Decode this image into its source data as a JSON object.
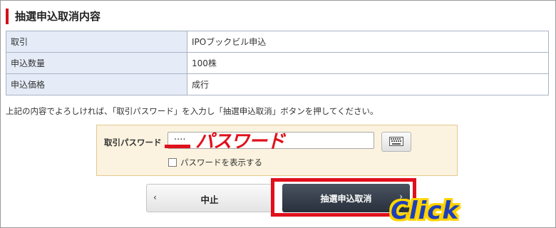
{
  "section_title": "抽選申込取消内容",
  "details": [
    {
      "label": "取引",
      "value": "IPOブックビル申込"
    },
    {
      "label": "申込数量",
      "value": "100株"
    },
    {
      "label": "申込価格",
      "value": "成行"
    }
  ],
  "note": "上記の内容でよろしければ、「取引パスワード」を入力し「抽選申込取消」ボタンを押してください。",
  "password": {
    "label": "取引パスワード",
    "value": "····",
    "show_password_label": "パスワードを表示する",
    "keyboard_icon": "keyboard-icon"
  },
  "buttons": {
    "stop_label": "中止",
    "cancel_label": "抽選申込取消"
  },
  "annotations": {
    "password_text": "パスワード",
    "click_text": "Click"
  },
  "colors": {
    "accent_red": "#e0101c",
    "table_header_bg": "#e5ecf7",
    "password_box_bg": "#fbf3df",
    "cancel_button_bg": "#27303b",
    "click_blue": "#1f3fb8",
    "click_yellow": "#ffd400"
  }
}
